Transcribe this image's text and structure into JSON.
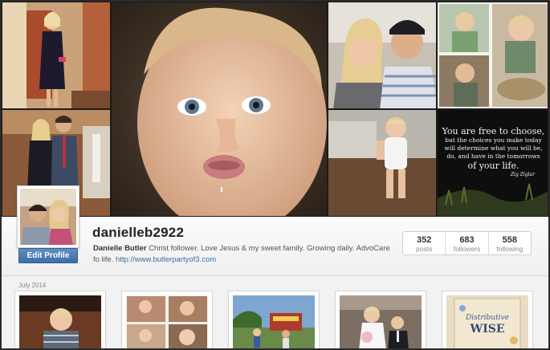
{
  "profile": {
    "username": "danielleb2922",
    "full_name": "Danielle Butler",
    "bio_text": "Christ follower. Love Jesus & my sweet family. Growing daily. AdvoCare fo life.",
    "website": "http://www.butlerpartyof3.com",
    "edit_label": "Edit Profile"
  },
  "stats": [
    {
      "value": "352",
      "label": "posts"
    },
    {
      "value": "683",
      "label": "followers"
    },
    {
      "value": "558",
      "label": "following"
    }
  ],
  "feed": {
    "month_label": "July 2014"
  },
  "quote_tile": {
    "line1": "You are free to choose,",
    "line2": "but the choices you make today",
    "line3": "will determine what you will be,",
    "line4": "do, and have in the tomorrows",
    "line5": "of your life.",
    "author": "Zig Ziglar"
  },
  "book_tile": {
    "title": "WISE",
    "subtitle": "Distributive"
  },
  "colors": {
    "accent": "#3e6ea6",
    "link": "#3a6ea5",
    "username": "#222222"
  }
}
